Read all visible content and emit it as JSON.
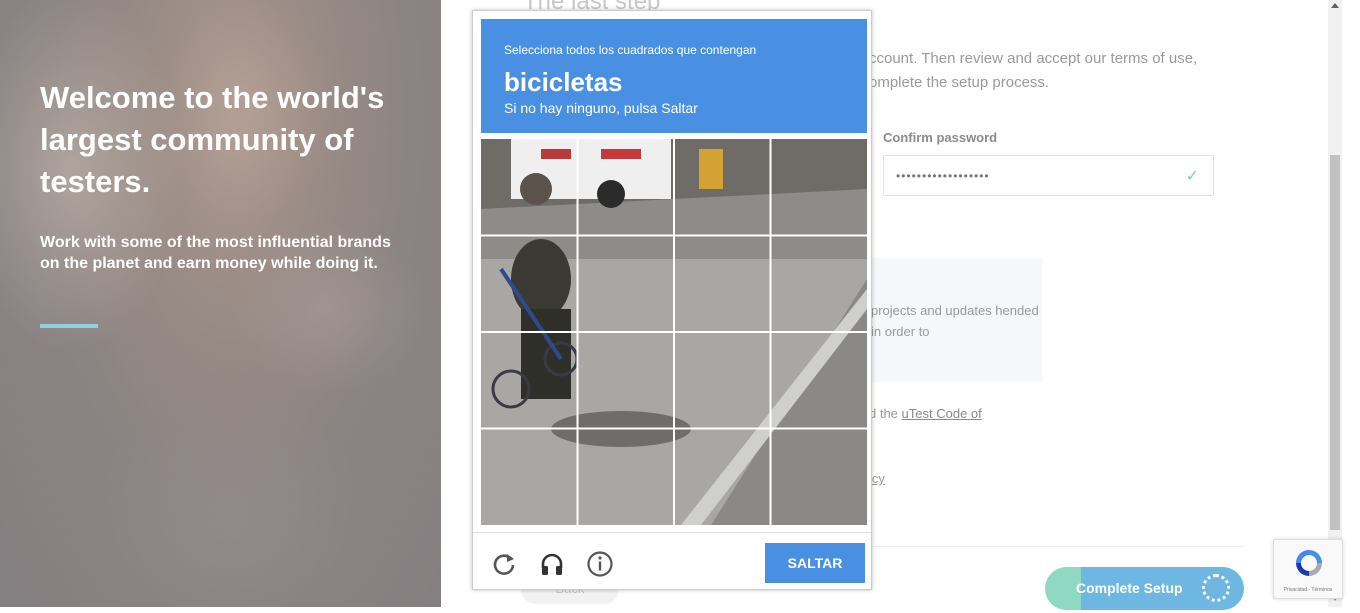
{
  "hero": {
    "title": "Welcome to the world's largest community of testers.",
    "subtitle": "Work with some of the most influential brands on the planet and earn money while doing it."
  },
  "form": {
    "step_title": "The last step",
    "intro_text": "ccount. Then review and accept our terms of use, omplete the setup process.",
    "confirm_password": {
      "label": "Confirm password",
      "value": "••••••••••••••••••"
    },
    "optin_text": "projects and updates hended in order to",
    "code_of_conduct_prefix": "d the",
    "code_of_conduct_link": "uTest Code of",
    "policy_link": "icy",
    "back_label": "Back",
    "complete_label": "Complete Setup"
  },
  "captcha": {
    "instruction": "Selecciona todos los cuadrados que contengan",
    "keyword": "bicicletas",
    "hint": "Si no hay ninguno, pulsa Saltar",
    "skip_label": "SALTAR",
    "tile_count": 16
  },
  "recaptcha_badge": {
    "footer": "Privacidad - Términos"
  },
  "colors": {
    "captcha_blue": "#4a90e2",
    "hero_rule": "#8fd0e0",
    "check_green": "#7fd0b3"
  },
  "icons": [
    "reload-icon",
    "headphones-icon",
    "info-icon",
    "check-icon",
    "recaptcha-logo-icon",
    "spinner-icon"
  ]
}
